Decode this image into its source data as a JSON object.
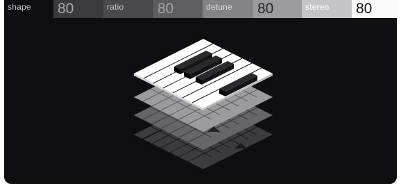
{
  "params": [
    {
      "label": "shape",
      "value": "80"
    },
    {
      "label": "ratio",
      "value": "80"
    },
    {
      "label": "detune",
      "value": "80"
    },
    {
      "label": "stereo",
      "value": "80"
    }
  ],
  "colors": {
    "background": "#0f0f12",
    "keyboard_white": "#ffffff",
    "keyboard_black": "#111111",
    "layer_light": "#9a9a9a",
    "layer_mid": "#6a6a6a",
    "layer_dark": "#3e3e3e"
  },
  "icons": {
    "main": "isometric-piano-keyboard-icon"
  }
}
